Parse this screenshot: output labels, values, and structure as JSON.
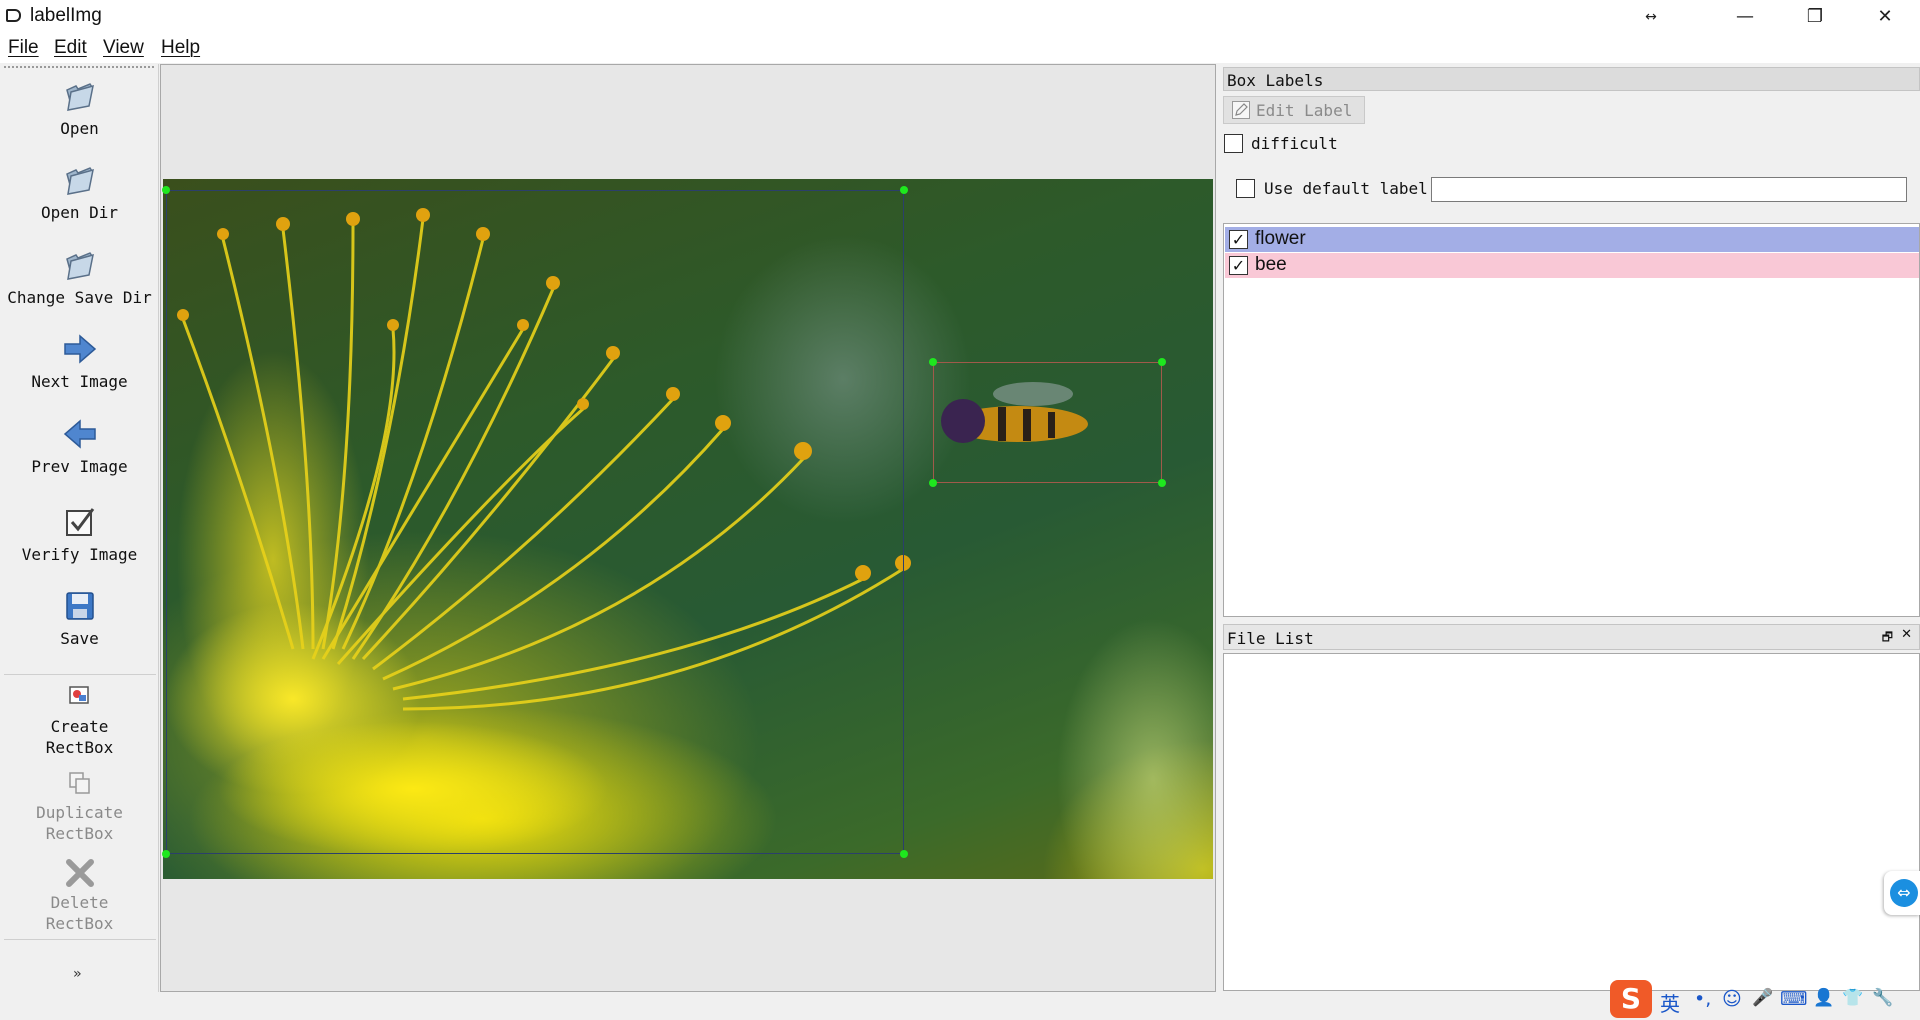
{
  "window": {
    "title": "labelImg",
    "extra_control": "↔",
    "minimize": "—",
    "maximize": "❐",
    "close": "✕"
  },
  "menu": [
    "File",
    "Edit",
    "View",
    "Help"
  ],
  "toolbar": {
    "open": "Open",
    "open_dir": "Open Dir",
    "change_save_dir": "Change Save Dir",
    "next_image": "Next Image",
    "prev_image": "Prev Image",
    "verify_image": "Verify Image",
    "save": "Save",
    "create_rectbox_1": "Create",
    "create_rectbox_2": "RectBox",
    "duplicate_rectbox_1": "Duplicate",
    "duplicate_rectbox_2": "RectBox",
    "delete_rectbox_1": "Delete",
    "delete_rectbox_2": "RectBox",
    "more": "»"
  },
  "box_labels": {
    "title": "Box Labels",
    "edit_label": "Edit Label",
    "difficult": "difficult",
    "use_default_label": "Use default label",
    "default_label_value": "",
    "items": [
      {
        "label": "flower",
        "checked": "✓",
        "color": "#a3aee6"
      },
      {
        "label": "bee",
        "checked": "✓",
        "color": "#f9c8d6"
      }
    ]
  },
  "file_list": {
    "title": "File List",
    "float_icon": "🗗",
    "close_icon": "✕"
  },
  "annotations": {
    "flower_box_color": "#2b3f6b",
    "bee_box_color": "#a05a4a",
    "handle_color": "#1ee81e"
  },
  "ime": {
    "logo": "S",
    "lang": "英",
    "punct": "•,",
    "emoji": "☺",
    "mic": "🎤",
    "keyboard": "⌨",
    "user": "👤",
    "skin": "👕",
    "tools": "🔧"
  },
  "side_widget": {
    "icon": "⇔"
  }
}
